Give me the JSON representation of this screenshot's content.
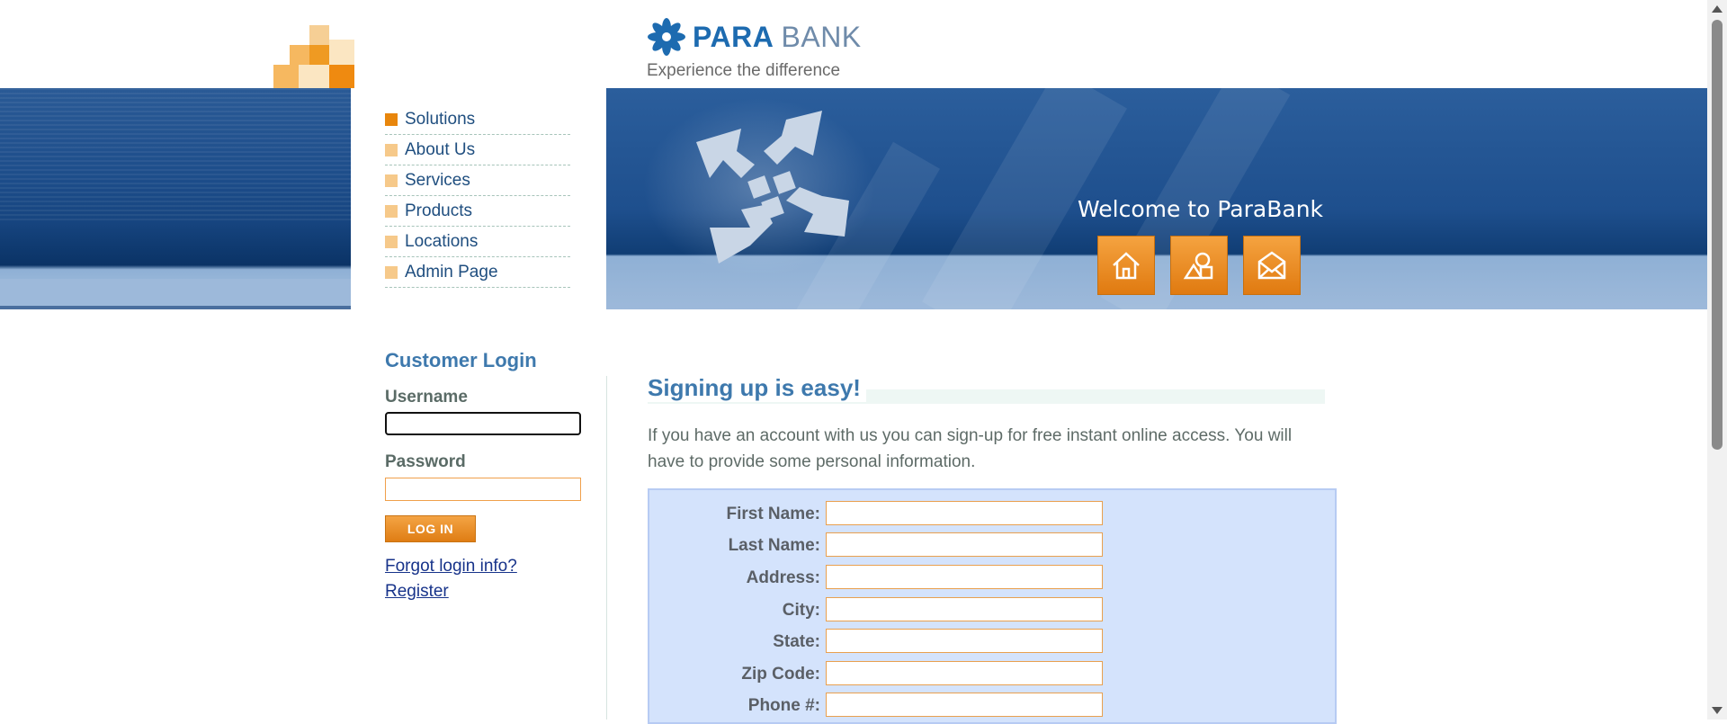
{
  "header": {
    "logo_primary": "PARA",
    "logo_secondary": "BANK",
    "tagline": "Experience the difference"
  },
  "banner": {
    "welcome": "Welcome to ParaBank",
    "icons": [
      "home-icon",
      "about-icon",
      "contact-icon"
    ]
  },
  "menu": {
    "items": [
      {
        "label": "Solutions"
      },
      {
        "label": "About Us"
      },
      {
        "label": "Services"
      },
      {
        "label": "Products"
      },
      {
        "label": "Locations"
      },
      {
        "label": "Admin Page"
      }
    ]
  },
  "login": {
    "title": "Customer Login",
    "username_label": "Username",
    "password_label": "Password",
    "button": "LOG IN",
    "forgot": "Forgot login info?",
    "register": "Register"
  },
  "main": {
    "title": "Signing up is easy!",
    "intro": "If you have an account with us you can sign-up for free instant online access. You will have to provide some personal information.",
    "fields": [
      {
        "label": "First Name:"
      },
      {
        "label": "Last Name:"
      },
      {
        "label": "Address:"
      },
      {
        "label": "City:"
      },
      {
        "label": "State:"
      },
      {
        "label": "Zip Code:"
      },
      {
        "label": "Phone #:"
      }
    ]
  },
  "colors": {
    "brand_blue": "#1d6bb0",
    "accent_orange": "#e8860c",
    "form_bg": "#d4e3fc"
  }
}
